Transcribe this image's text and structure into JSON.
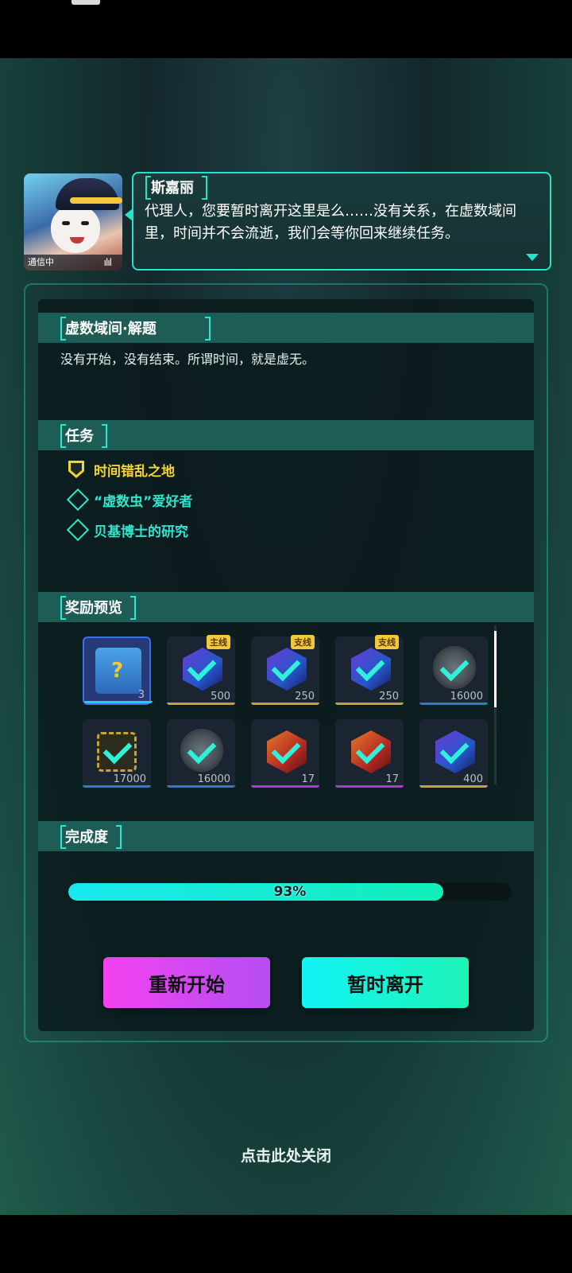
{
  "dialog": {
    "speaker": "斯嘉丽",
    "text": "代理人，您要暂时离开这里是么……没有关系，在虚数域间里，时间并不会流逝，我们会等你回来继续任务。",
    "avatar_status": "通信中",
    "avatar_wave": "ılıl"
  },
  "puzzle": {
    "title": "虚数域间·解题",
    "description": "没有开始，没有结束。所谓时间，就是虚无。"
  },
  "missions": {
    "title": "任务",
    "items": [
      {
        "label": "时间错乱之地",
        "icon": "main-quest-shield-icon",
        "color": "#f2d435"
      },
      {
        "label": "“虚数虫”爱好者",
        "icon": "side-quest-diamond-icon",
        "color": "#2fe6cc"
      },
      {
        "label": "贝基博士的研究",
        "icon": "side-quest-diamond-icon",
        "color": "#2fe6cc"
      }
    ]
  },
  "rewards": {
    "title": "奖励预览",
    "items": [
      {
        "icon": "mystery-chest-icon",
        "qty": "3",
        "tag": "",
        "rarity": "#1fd2e6"
      },
      {
        "icon": "blue-cube-icon",
        "qty": "500",
        "tag": "主线",
        "rarity": "#c9a13a"
      },
      {
        "icon": "blue-cube-icon",
        "qty": "250",
        "tag": "支线",
        "rarity": "#c9a13a"
      },
      {
        "icon": "blue-cube-icon",
        "qty": "250",
        "tag": "支线",
        "rarity": "#c9a13a"
      },
      {
        "icon": "silver-coin-icon",
        "qty": "16000",
        "tag": "",
        "rarity": "#2a7bd8"
      },
      {
        "icon": "gold-chip-icon",
        "qty": "17000",
        "tag": "",
        "rarity": "#2a7bd8"
      },
      {
        "icon": "silver-coin-icon",
        "qty": "16000",
        "tag": "",
        "rarity": "#2a7bd8"
      },
      {
        "icon": "red-cube-icon",
        "qty": "17",
        "tag": "",
        "rarity": "#b13ad8"
      },
      {
        "icon": "red-cube-icon",
        "qty": "17",
        "tag": "",
        "rarity": "#b13ad8"
      },
      {
        "icon": "blue-cube-icon",
        "qty": "400",
        "tag": "",
        "rarity": "#c9a13a"
      }
    ]
  },
  "completion": {
    "title": "完成度",
    "value": 0.93,
    "label": "93%"
  },
  "buttons": {
    "restart": "重新开始",
    "leave": "暂时离开"
  },
  "close_hint": "点击此处关闭"
}
